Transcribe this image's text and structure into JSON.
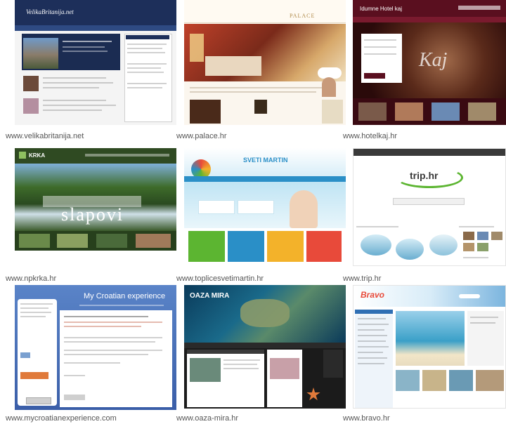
{
  "thumbnails": [
    {
      "caption": "www.velikabritanija.net",
      "logo": "VelikaBritanija.net"
    },
    {
      "caption": "www.palace.hr",
      "logo": "PALACE"
    },
    {
      "caption": "www.hotelkaj.hr",
      "logo": "Kaj",
      "header_text": "Idumne Hotel kaj"
    },
    {
      "caption": "www.npkrka.hr",
      "logo": "KRKA",
      "hero_text": "slapovi"
    },
    {
      "caption": "www.toplicesvetimartin.hr",
      "logo": "SVETI MARTIN"
    },
    {
      "caption": "www.trip.hr",
      "logo": "trip.hr"
    },
    {
      "caption": "www.mycroatianexperience.com",
      "logo": "My Croatian experience"
    },
    {
      "caption": "www.oaza-mira.hr",
      "logo": "OAZA MIRA"
    },
    {
      "caption": "www.bravo.hr",
      "logo": "Bravo"
    }
  ],
  "colors": {
    "caption_text": "#555555",
    "velikabritanija_header": "#1d2f5a",
    "hotelkaj_header": "#5a0f1f",
    "npkrka_green": "#3e6b2a",
    "toplice_blue": "#2a8fc7",
    "trip_green": "#5cb531",
    "mycroatian_blue": "#4a71b8",
    "oaza_dark": "#1b1b1b",
    "bravo_blue": "#2f6fb4"
  }
}
